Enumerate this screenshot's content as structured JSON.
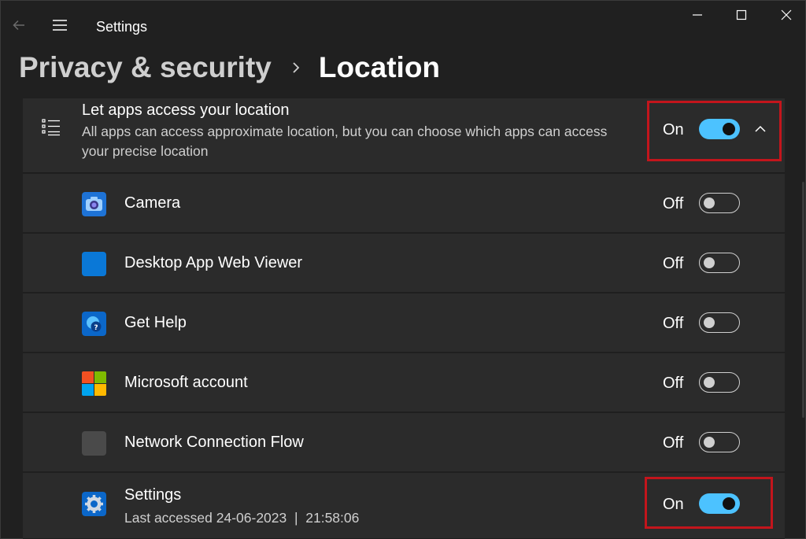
{
  "window": {
    "title": "Settings"
  },
  "breadcrumb": {
    "parent": "Privacy & security",
    "current": "Location"
  },
  "location_access": {
    "title": "Let apps access your location",
    "description": "All apps can access approximate location, but you can choose which apps can access your precise location",
    "state": "On",
    "enabled": true
  },
  "apps": [
    {
      "name": "Camera",
      "state": "Off",
      "enabled": false,
      "icon": "camera-icon"
    },
    {
      "name": "Desktop App Web Viewer",
      "state": "Off",
      "enabled": false,
      "icon": "web-viewer-icon"
    },
    {
      "name": "Get Help",
      "state": "Off",
      "enabled": false,
      "icon": "get-help-icon"
    },
    {
      "name": "Microsoft account",
      "state": "Off",
      "enabled": false,
      "icon": "microsoft-logo-icon"
    },
    {
      "name": "Network Connection Flow",
      "state": "Off",
      "enabled": false,
      "icon": "network-flow-icon"
    },
    {
      "name": "Settings",
      "sub": "Last accessed 24-06-2023  |  21:58:06",
      "state": "On",
      "enabled": true,
      "icon": "settings-gear-icon"
    }
  ],
  "colors": {
    "accent": "#4cc2ff",
    "highlight": "#c3151c",
    "background": "#202020",
    "card": "#2b2b2b"
  }
}
